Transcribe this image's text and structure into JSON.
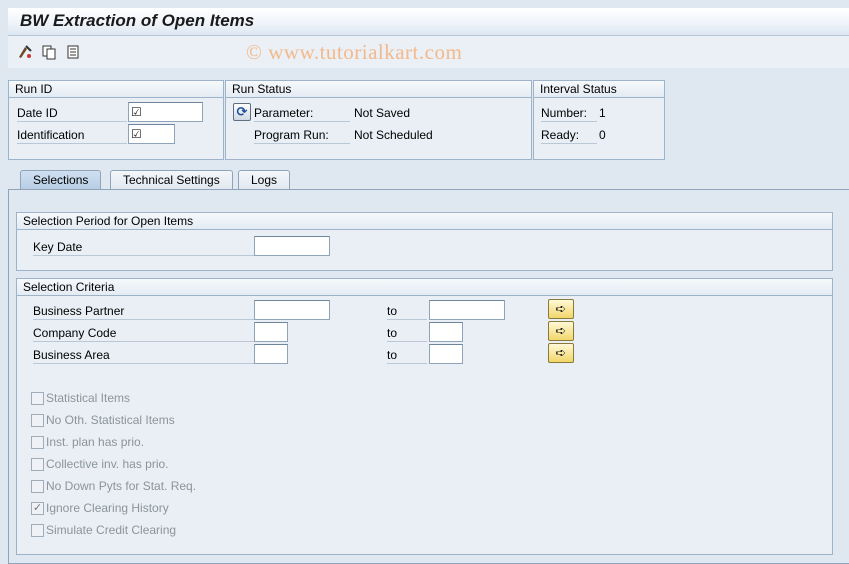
{
  "window": {
    "title": "BW Extraction of Open Items"
  },
  "toolbar": {
    "icons": [
      "execute-icon",
      "copy-icon",
      "variant-icon"
    ]
  },
  "watermark": "© www.tutorialkart.com",
  "run_id": {
    "header": "Run ID",
    "date_id_label": "Date ID",
    "identification_label": "Identification"
  },
  "run_status": {
    "header": "Run Status",
    "parameter_label": "Parameter:",
    "parameter_value": "Not Saved",
    "program_run_label": "Program Run:",
    "program_run_value": "Not Scheduled"
  },
  "interval_status": {
    "header": "Interval Status",
    "number_label": "Number:",
    "number_value": "1",
    "ready_label": "Ready:",
    "ready_value": "0"
  },
  "tabs": [
    {
      "label": "Selections",
      "active": true
    },
    {
      "label": "Technical Settings",
      "active": false
    },
    {
      "label": "Logs",
      "active": false
    }
  ],
  "selection_period": {
    "header": "Selection Period for Open Items",
    "key_date_label": "Key Date",
    "key_date_value": ""
  },
  "selection_criteria": {
    "header": "Selection Criteria",
    "to_label": "to",
    "rows": [
      {
        "label": "Business Partner"
      },
      {
        "label": "Company Code"
      },
      {
        "label": "Business Area"
      }
    ]
  },
  "checkboxes": [
    {
      "label": "Statistical Items",
      "checked": false
    },
    {
      "label": "No Oth. Statistical Items",
      "checked": false
    },
    {
      "label": "Inst. plan has prio.",
      "checked": false
    },
    {
      "label": "Collective inv. has prio.",
      "checked": false
    },
    {
      "label": "No Down Pyts for Stat. Req.",
      "checked": false
    },
    {
      "label": "Ignore Clearing History",
      "checked": true
    },
    {
      "label": "Simulate Credit Clearing",
      "checked": false
    }
  ]
}
